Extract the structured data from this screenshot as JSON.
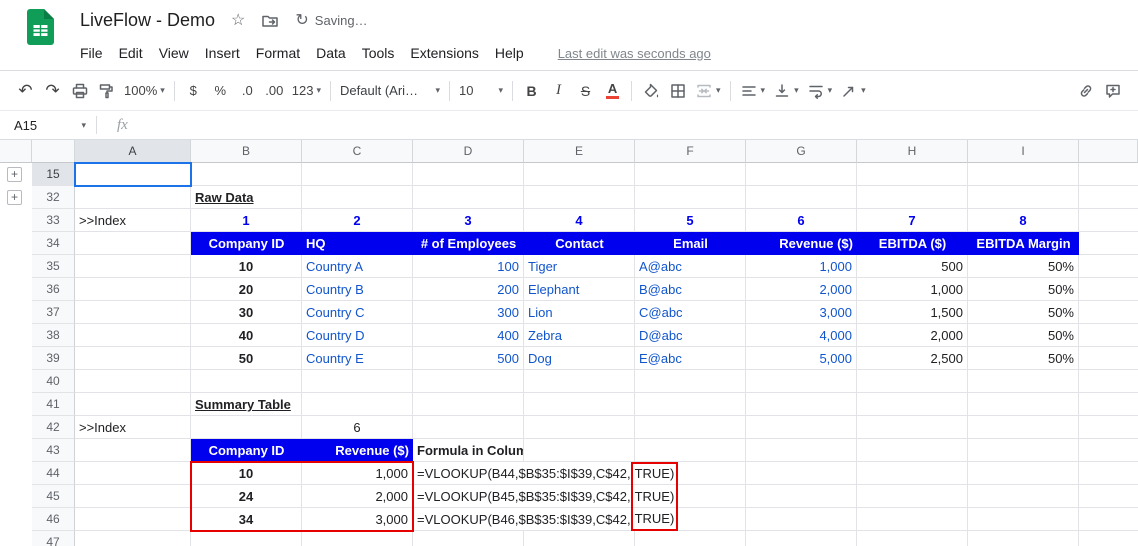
{
  "app": {
    "title": "LiveFlow - Demo",
    "saving_status": "Saving…",
    "menus": [
      "File",
      "Edit",
      "View",
      "Insert",
      "Format",
      "Data",
      "Tools",
      "Extensions",
      "Help"
    ],
    "last_edit": "Last edit was seconds ago"
  },
  "toolbar": {
    "zoom": "100%",
    "currency": "$",
    "percent": "%",
    "decrease_decimal": ".0",
    "increase_decimal": ".00",
    "more_formats": "123",
    "font_name": "Default (Ari…",
    "font_size": "10",
    "bold": "B",
    "italic": "I",
    "strikethrough": "S",
    "text_color": "A"
  },
  "formula_bar": {
    "name_box": "A15",
    "fx": "fx"
  },
  "icons": {
    "caret": "▾",
    "undo": "↶",
    "redo": "↷",
    "star": "☆",
    "sync": "↻"
  },
  "grid": {
    "column_headers": [
      "A",
      "B",
      "C",
      "D",
      "E",
      "F",
      "G",
      "H",
      "I"
    ],
    "row_numbers": [
      "15",
      "32",
      "33",
      "34",
      "35",
      "36",
      "37",
      "38",
      "39",
      "40",
      "41",
      "42",
      "43",
      "44",
      "45",
      "46",
      "47"
    ],
    "group_expand": "+",
    "selected_cell": "A15"
  },
  "sheet": {
    "raw": {
      "title": "Raw Data",
      "index_label": ">>Index",
      "index": [
        "1",
        "2",
        "3",
        "4",
        "5",
        "6",
        "7",
        "8"
      ],
      "headers": [
        "Company ID",
        "HQ",
        "# of Employees",
        "Contact",
        "Email",
        "Revenue ($)",
        "EBITDA ($)",
        "EBITDA Margin"
      ],
      "rows": [
        [
          "10",
          "Country A",
          "100",
          "Tiger",
          "A@abc",
          "1,000",
          "500",
          "50%"
        ],
        [
          "20",
          "Country B",
          "200",
          "Elephant",
          "B@abc",
          "2,000",
          "1,000",
          "50%"
        ],
        [
          "30",
          "Country C",
          "300",
          "Lion",
          "C@abc",
          "3,000",
          "1,500",
          "50%"
        ],
        [
          "40",
          "Country D",
          "400",
          "Zebra",
          "D@abc",
          "4,000",
          "2,000",
          "50%"
        ],
        [
          "50",
          "Country E",
          "500",
          "Dog",
          "E@abc",
          "5,000",
          "2,500",
          "50%"
        ]
      ]
    },
    "summary": {
      "title": "Summary Table",
      "index_label": ">>Index",
      "index_value": "6",
      "headers": [
        "Company ID",
        "Revenue ($)"
      ],
      "caption": "Formula in Column C",
      "rows": [
        {
          "id": "10",
          "revenue": "1,000",
          "formula": "=VLOOKUP(B44,$B$35:$I$39,C$42,",
          "highlight": "TRUE)"
        },
        {
          "id": "24",
          "revenue": "2,000",
          "formula": "=VLOOKUP(B45,$B$35:$I$39,C$42,",
          "highlight": "TRUE)"
        },
        {
          "id": "34",
          "revenue": "3,000",
          "formula": "=VLOOKUP(B46,$B$35:$I$39,C$42,",
          "highlight": "TRUE)"
        }
      ]
    }
  },
  "colors": {
    "table_header_bg": "#0000ee",
    "blue_text": "#1155cc",
    "highlight_red": "#e60000",
    "selection_blue": "#1a73e8",
    "sheets_green": "#0f9d58"
  }
}
